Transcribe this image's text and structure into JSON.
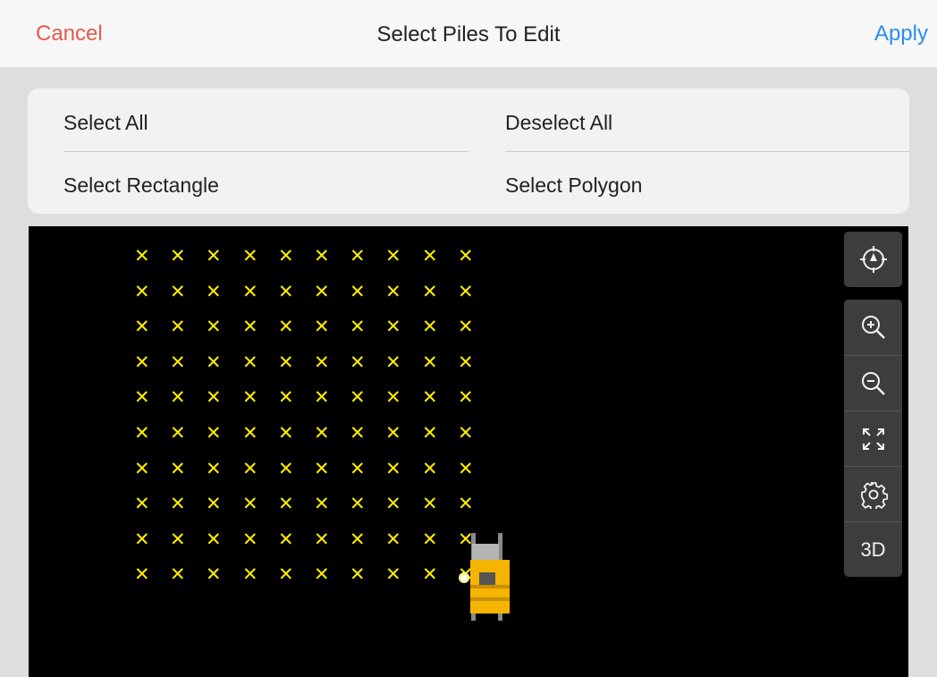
{
  "header": {
    "cancel_label": "Cancel",
    "title": "Select Piles To Edit",
    "apply_label": "Apply"
  },
  "selection_panel": {
    "select_all": "Select All",
    "deselect_all": "Deselect All",
    "select_rectangle": "Select Rectangle",
    "select_polygon": "Select Polygon"
  },
  "map": {
    "pile_marker": "✕",
    "pile_grid": {
      "rows": 10,
      "columns": 10
    },
    "toolbar": {
      "recenter": "recenter-icon",
      "zoom_in": "zoom-in-icon",
      "zoom_out": "zoom-out-icon",
      "fit": "fit-extent-icon",
      "settings": "gear-icon",
      "view_3d_label": "3D"
    }
  },
  "colors": {
    "cancel": "#e8584b",
    "apply": "#2b8df0",
    "pile": "#ffee00",
    "map_background": "#000000",
    "toolbar": "#3d3d3d",
    "machine": "#f5b400"
  }
}
